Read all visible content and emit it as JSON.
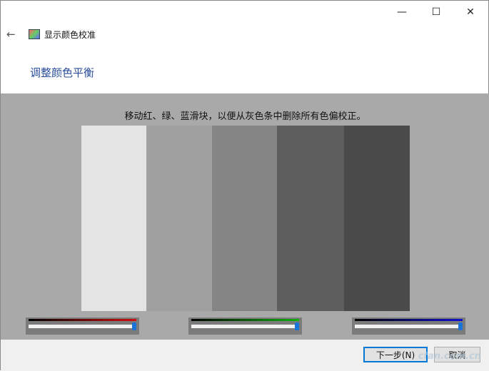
{
  "window": {
    "minimize": "—",
    "maximize": "☐",
    "close": "✕"
  },
  "header": {
    "back": "←",
    "app_title": "显示颜色校准",
    "heading": "调整颜色平衡"
  },
  "main": {
    "instruction": "移动红、绿、蓝滑块，以便从灰色条中删除所有色偏校正。",
    "bars": [
      "#e4e4e4",
      "#a0a0a0",
      "#858585",
      "#5e5e5e",
      "#4a4a4a"
    ],
    "sliders": [
      {
        "name": "red",
        "color": "#d01010",
        "value": 1.0
      },
      {
        "name": "green",
        "color": "#10b010",
        "value": 1.0
      },
      {
        "name": "blue",
        "color": "#1010d0",
        "value": 1.0
      }
    ]
  },
  "footer": {
    "next": "下一步(N)",
    "cancel": "取消",
    "watermark": "cfan.com.cn"
  }
}
